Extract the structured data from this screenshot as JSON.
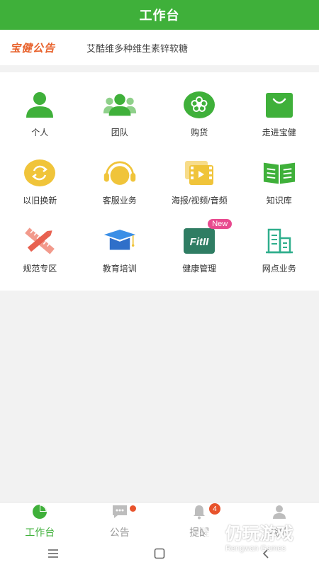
{
  "header": {
    "title": "工作台"
  },
  "notice": {
    "brand": "宝健公告",
    "text": "艾酷维多种维生素锌软糖"
  },
  "grid": {
    "items": [
      {
        "label": "个人",
        "icon": "person-icon"
      },
      {
        "label": "团队",
        "icon": "team-icon"
      },
      {
        "label": "购货",
        "icon": "flower-icon"
      },
      {
        "label": "走进宝健",
        "icon": "shopping-bag-icon"
      },
      {
        "label": "以旧换新",
        "icon": "exchange-icon"
      },
      {
        "label": "客服业务",
        "icon": "headphones-icon"
      },
      {
        "label": "海报/视频/音频",
        "icon": "media-icon"
      },
      {
        "label": "知识库",
        "icon": "book-icon"
      },
      {
        "label": "规范专区",
        "icon": "ruler-pencil-icon"
      },
      {
        "label": "教育培训",
        "icon": "graduation-cap-icon"
      },
      {
        "label": "健康管理",
        "icon": "fitii-icon",
        "badge": "New",
        "icon_text": "FitII"
      },
      {
        "label": "网点业务",
        "icon": "building-icon"
      }
    ]
  },
  "tabbar": {
    "tabs": [
      {
        "label": "工作台",
        "active": true
      },
      {
        "label": "公告",
        "dot": true
      },
      {
        "label": "提醒",
        "count": "4"
      },
      {
        "label": "我的"
      }
    ]
  },
  "watermark": {
    "cn": "仍玩游戏",
    "en": "Rengwan Games"
  },
  "colors": {
    "primary": "#3fb03a",
    "brand": "#e8622c",
    "badge": "#e84a8f",
    "alert": "#e8532c"
  }
}
